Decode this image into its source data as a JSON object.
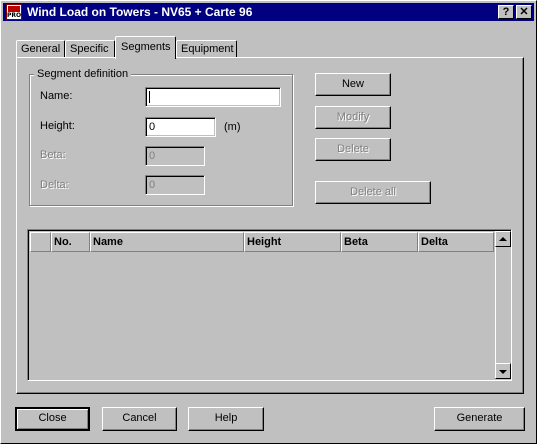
{
  "window": {
    "title": "Wind Load on Towers - NV65 + Carte 96",
    "app_icon_text": "PRO",
    "help_button": "?",
    "close_button": "✕"
  },
  "tabs": [
    {
      "label": "General",
      "active": false
    },
    {
      "label": "Specific",
      "active": false
    },
    {
      "label": "Segments",
      "active": true
    },
    {
      "label": "Equipment",
      "active": false
    }
  ],
  "segment_definition": {
    "group_title": "Segment definition",
    "name_label": "Name:",
    "name_value": "",
    "height_label": "Height:",
    "height_value": "0",
    "height_unit": "(m)",
    "beta_label": "Beta:",
    "beta_value": "0",
    "delta_label": "Delta:",
    "delta_value": "0"
  },
  "actions": {
    "new": "New",
    "modify": "Modify",
    "delete": "Delete",
    "delete_all": "Delete all"
  },
  "table": {
    "columns": [
      "",
      "No.",
      "Name",
      "Height",
      "Beta",
      "Delta"
    ],
    "rows": []
  },
  "footer": {
    "close": "Close",
    "cancel": "Cancel",
    "help": "Help",
    "generate": "Generate"
  }
}
